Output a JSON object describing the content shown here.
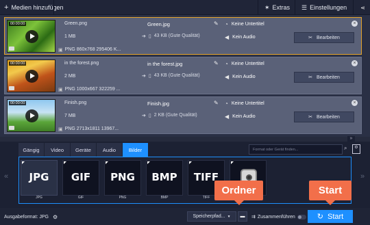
{
  "topbar": {
    "add_media_label": "Medien hinzufügen",
    "extras_label": "Extras",
    "settings_label": "Einstellungen"
  },
  "files": [
    {
      "source_name": "Green.png",
      "source_size": "1 MB",
      "source_info": "PNG 860x768 295406 K...",
      "timecode": "00:00:00",
      "output_name": "Green.jpg",
      "output_size": "43 KB (Gute Qualität)",
      "subtitle": "Keine Untertitel",
      "audio": "Kein Audio",
      "edit_label": "Bearbeiten",
      "selected": true
    },
    {
      "source_name": "in the forest.png",
      "source_size": "2 MB",
      "source_info": "PNG 1000x667 322259 ...",
      "timecode": "00:00:00",
      "output_name": "in the forest.jpg",
      "output_size": "43 KB (Gute Qualität)",
      "subtitle": "Keine Untertitel",
      "audio": "Kein Audio",
      "edit_label": "Bearbeiten",
      "selected": false
    },
    {
      "source_name": "Finish.png",
      "source_size": "7 MB",
      "source_info": "PNG 2713x1811 13967...",
      "timecode": "00:00:00",
      "output_name": "Finish.jpg",
      "output_size": "2 KB (Gute Qualität)",
      "subtitle": "Keine Untertitel",
      "audio": "Kein Audio",
      "edit_label": "Bearbeiten",
      "selected": false
    }
  ],
  "tabs": [
    "Gängig",
    "Video",
    "Geräte",
    "Audio",
    "Bilder"
  ],
  "active_tab": "Bilder",
  "search": {
    "placeholder": "Format oder Gerät finden..."
  },
  "formats": [
    {
      "badge": "JPG",
      "label": "JPG"
    },
    {
      "badge": "GIF",
      "label": "GIF"
    },
    {
      "badge": "PNG",
      "label": "PNG"
    },
    {
      "badge": "BMP",
      "label": "BMP"
    },
    {
      "badge": "TIFF",
      "label": "TIFF"
    },
    {
      "badge": "",
      "label": "Instagram"
    }
  ],
  "statusbar": {
    "output_format": "Ausgabeformat: JPG",
    "save_path_label": "Speicherpfad...",
    "merge_label": "Zusammenführen",
    "start_label": "Start"
  },
  "callouts": {
    "folder": "Ordner",
    "start": "Start"
  },
  "colors": {
    "accent": "#1e90ff",
    "selection_border": "#e6a52a",
    "callout": "#f26f4a"
  }
}
